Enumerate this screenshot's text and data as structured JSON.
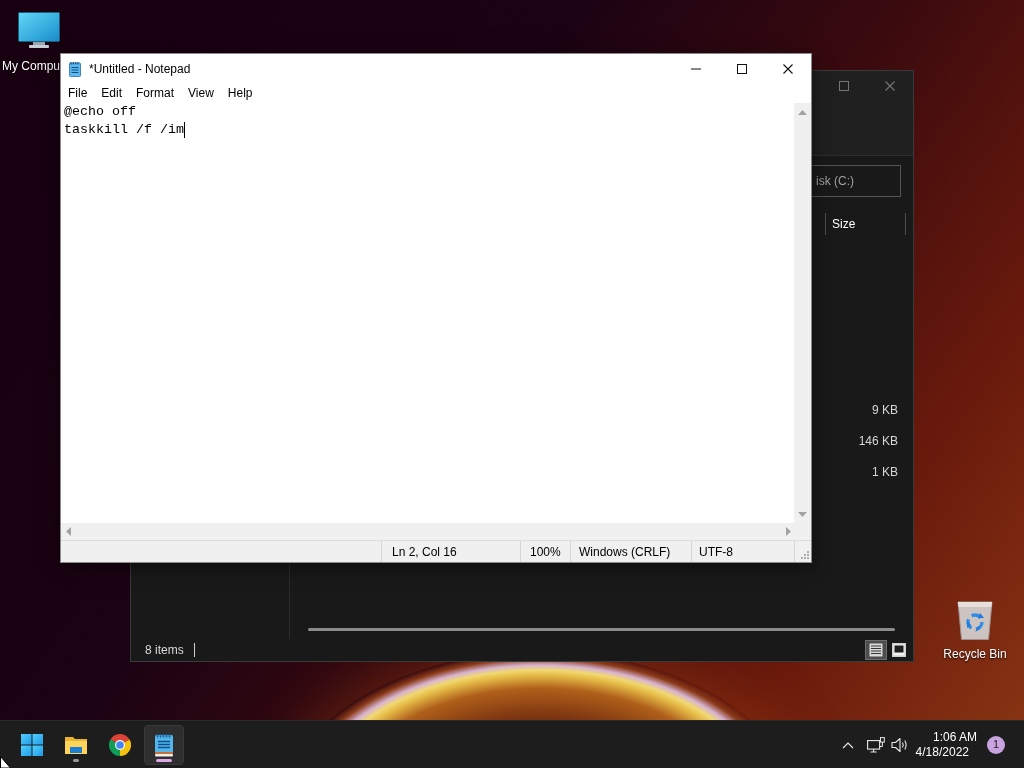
{
  "desktop_icons": [
    {
      "kind": "computer",
      "label": "My Compu"
    },
    {
      "kind": "recycle_bin",
      "label": "Recycle Bin"
    }
  ],
  "explorer_window": {
    "address": "isk (C:)",
    "columns": [
      "Size"
    ],
    "sizes": [
      "9 KB",
      "146 KB",
      "1 KB"
    ],
    "status": "8 items",
    "view_buttons": [
      {
        "kind": "details",
        "selected": true
      },
      {
        "kind": "thumbnails",
        "selected": false
      }
    ]
  },
  "notepad_window": {
    "title": "*Untitled - Notepad",
    "menu": [
      "File",
      "Edit",
      "Format",
      "View",
      "Help"
    ],
    "lines": [
      "@echo off",
      "taskkill /f /im"
    ],
    "status_bar": [
      "Ln 2, Col 16",
      "100%",
      "Windows (CRLF)",
      "UTF-8"
    ]
  },
  "taskbar": {
    "apps": [
      {
        "kind": "start",
        "running": false,
        "selected": false
      },
      {
        "kind": "explorer",
        "running": true,
        "selected": false
      },
      {
        "kind": "chrome",
        "running": false,
        "selected": false
      },
      {
        "kind": "notepad",
        "running": true,
        "selected": true
      }
    ],
    "clock": {
      "time": "1:06 AM",
      "date": "4/18/2022"
    },
    "notification_count": "1"
  }
}
